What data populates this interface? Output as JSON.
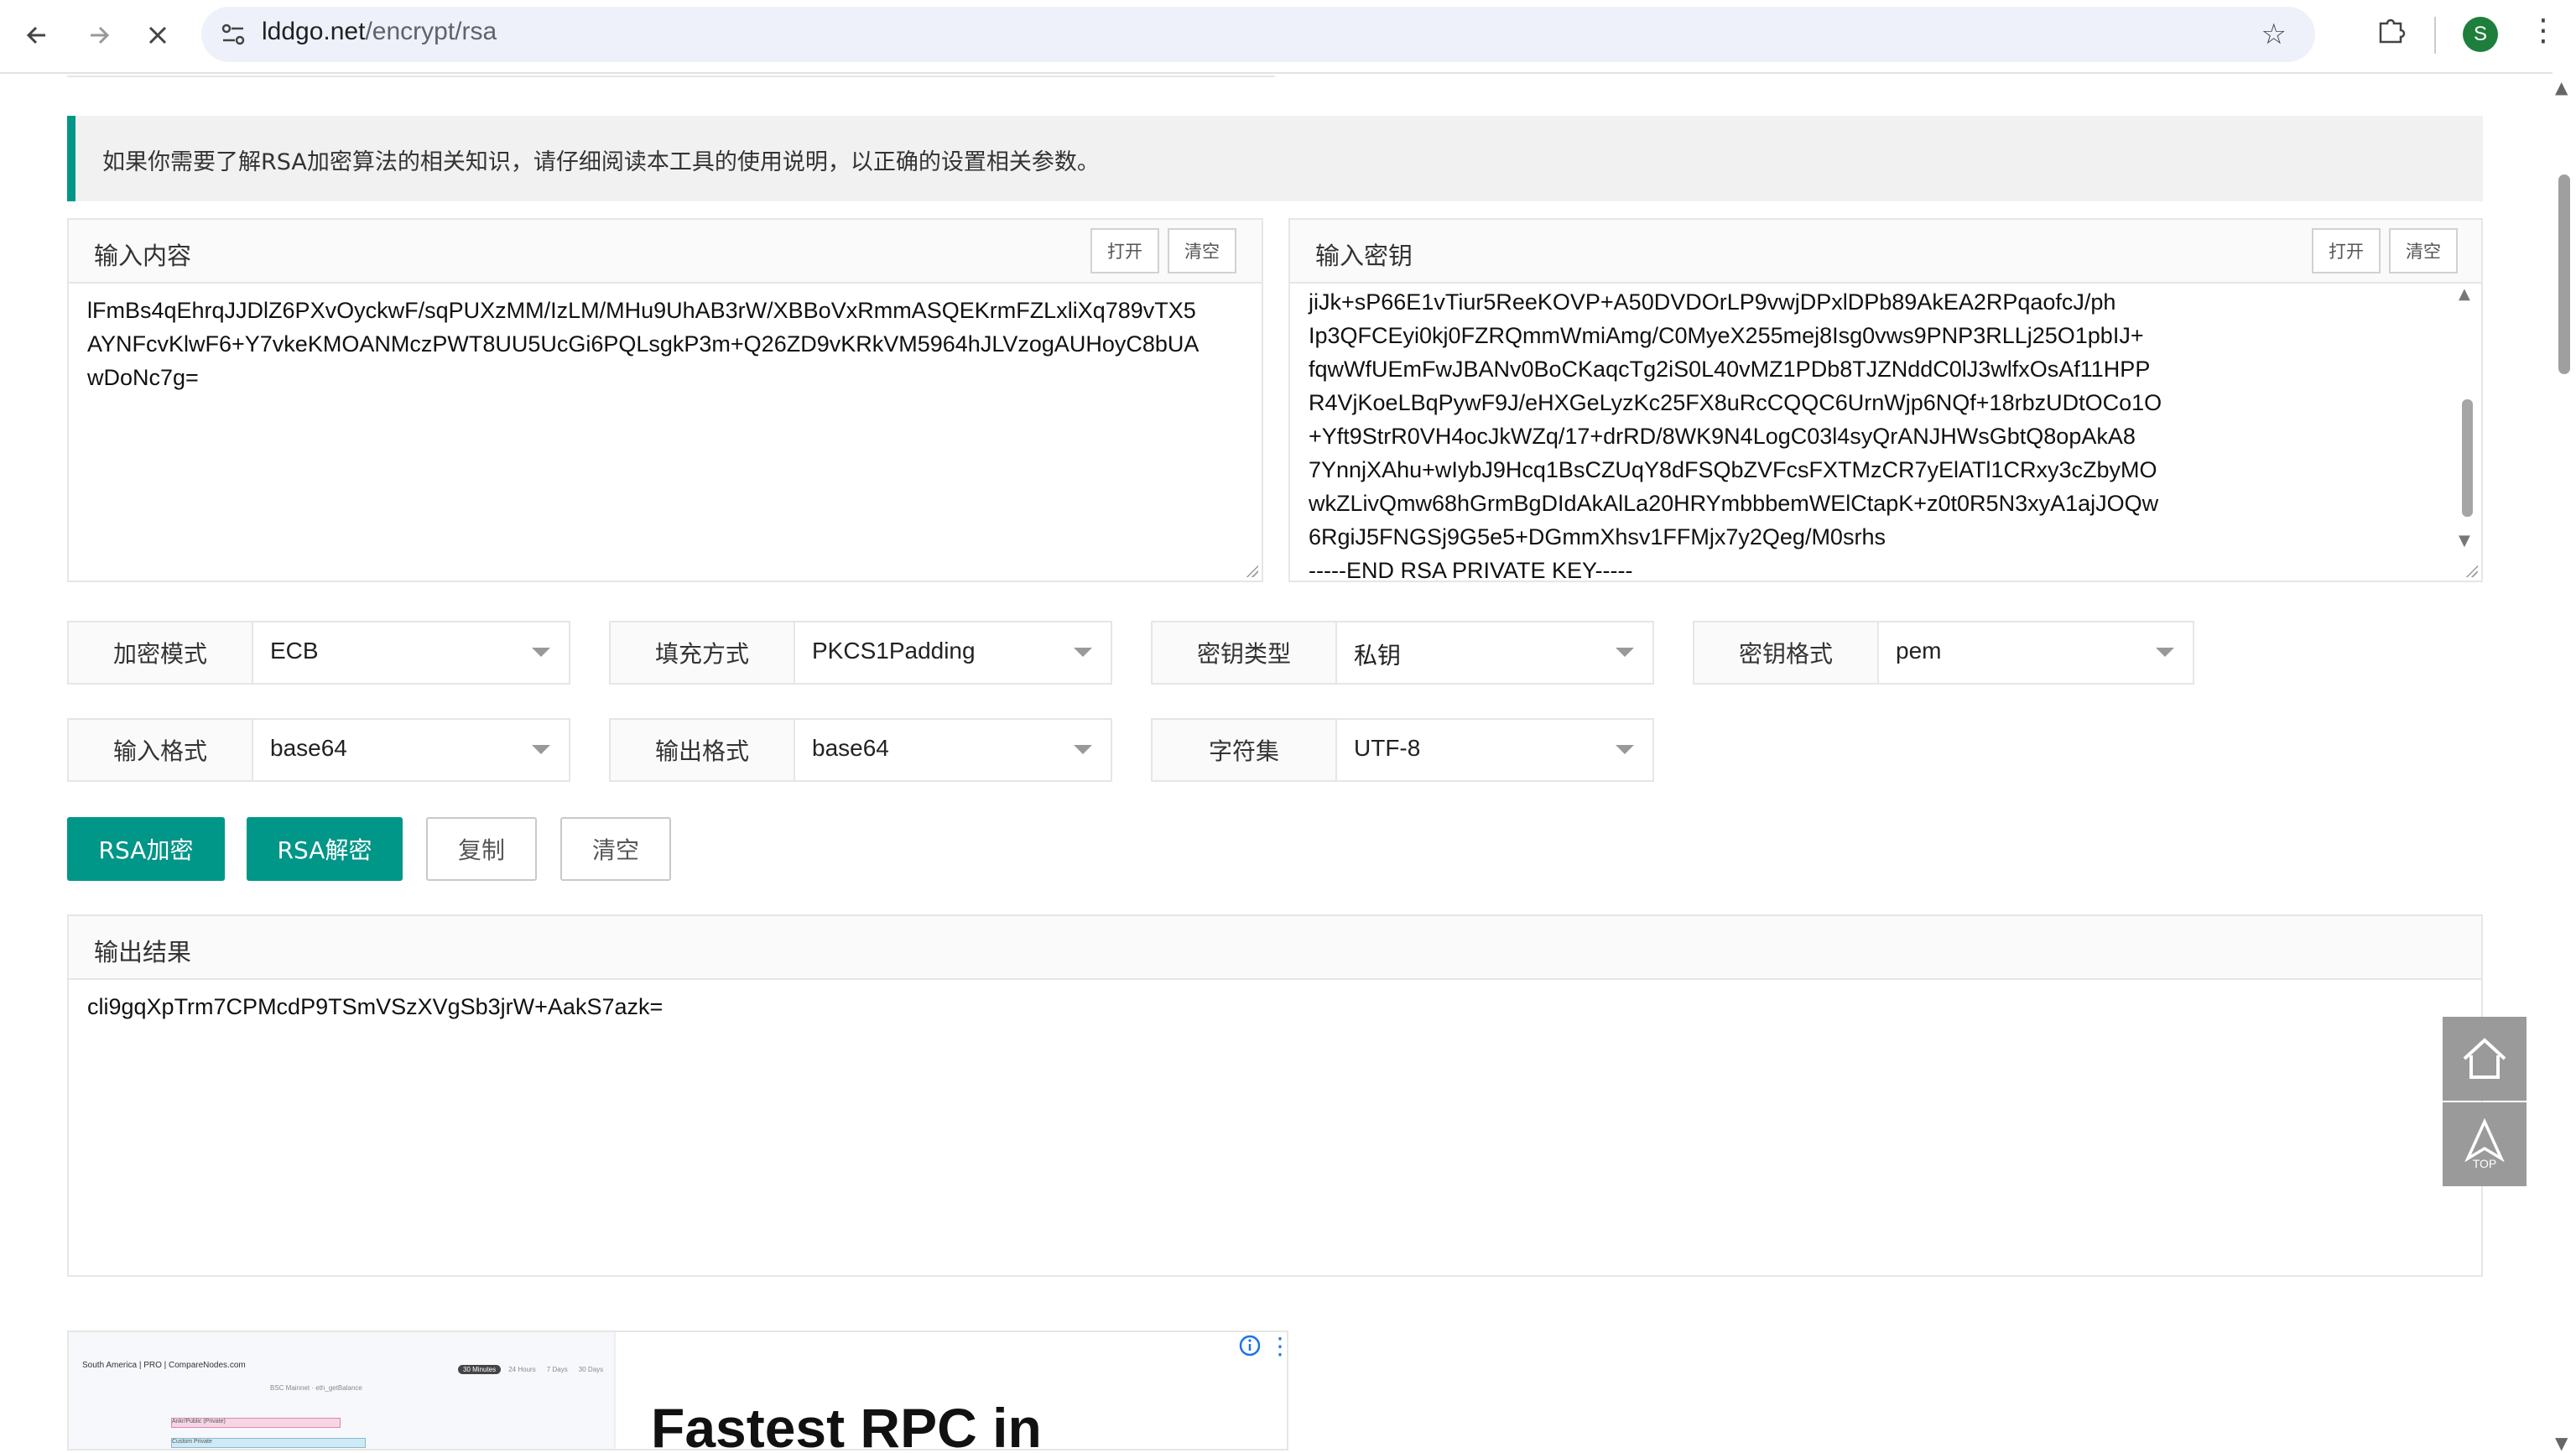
{
  "browser": {
    "url_host": "lddgo.net",
    "url_path": "/encrypt/rsa",
    "profile_initial": "S",
    "icons": {
      "back": "back-arrow-icon",
      "forward": "forward-arrow-icon",
      "stop": "close-icon",
      "site_info": "site-info-icon",
      "bookmark": "star-icon",
      "extensions": "puzzle-icon",
      "menu": "kebab-menu-icon"
    }
  },
  "notice": {
    "text": "如果你需要了解RSA加密算法的相关知识，请仔细阅读本工具的使用说明，以正确的设置相关参数。",
    "accent_color": "#009688"
  },
  "input_panel": {
    "title": "输入内容",
    "open_label": "打开",
    "clear_label": "清空",
    "lines": [
      "lFmBs4qEhrqJJDlZ6PXvOyckwF/sqPUXzMM/IzLM/MHu9UhAB3rW/XBBoVxRmmASQEKrmFZLxliXq789vTX5",
      "AYNFcvKlwF6+Y7vkeKMOANMczPWT8UU5UcGi6PQLsgkP3m+Q26ZD9vKRkVM5964hJLVzogAUHoyC8bUA",
      "wDoNc7g="
    ]
  },
  "key_panel": {
    "title": "输入密钥",
    "open_label": "打开",
    "clear_label": "清空",
    "lines": [
      "jiJk+sP66E1vTiur5ReeKOVP+A50DVDOrLP9vwjDPxlDPb89AkEA2RPqaofcJ/ph",
      "Ip3QFCEyi0kj0FZRQmmWmiAmg/C0MyeX255mej8Isg0vws9PNP3RLLj25O1pbIJ+",
      "fqwWfUEmFwJBANv0BoCKaqcTg2iS0L40vMZ1PDb8TJZNddC0lJ3wlfxOsAf11HPP",
      "R4VjKoeLBqPywF9J/eHXGeLyzKc25FX8uRcCQQC6UrnWjp6NQf+18rbzUDtOCo1O",
      "+Yft9StrR0VH4ocJkWZq/17+drRD/8WK9N4LogC03l4syQrANJHWsGbtQ8opAkA8",
      "7YnnjXAhu+wIybJ9Hcq1BsCZUqY8dFSQbZVFcsFXTMzCR7yElATl1CRxy3cZbyMO",
      "wkZLivQmw68hGrmBgDIdAkAlLa20HRYmbbbemWElCtapK+z0t0R5N3xyA1ajJOQw",
      "6RgiJ5FNGSj9G5e5+DGmmXhsv1FFMjx7y2Qeg/M0srhs",
      "-----END RSA PRIVATE KEY-----"
    ],
    "scrollbar": {
      "position_fraction": 0.6
    }
  },
  "options": [
    {
      "label": "加密模式",
      "value": "ECB"
    },
    {
      "label": "填充方式",
      "value": "PKCS1Padding"
    },
    {
      "label": "密钥类型",
      "value": "私钥"
    },
    {
      "label": "密钥格式",
      "value": "pem"
    },
    {
      "label": "输入格式",
      "value": "base64"
    },
    {
      "label": "输出格式",
      "value": "base64"
    },
    {
      "label": "字符集",
      "value": "UTF-8"
    }
  ],
  "actions": {
    "encrypt_label": "RSA加密",
    "decrypt_label": "RSA解密",
    "copy_label": "复制",
    "clear_label": "清空"
  },
  "output_panel": {
    "title": "输出结果",
    "value": "cli9gqXpTrm7CPMcdP9TSmVSzXVgSb3jrW+AakS7azk="
  },
  "float_buttons": {
    "home_icon": "home-icon",
    "top_icon": "back-to-top-icon",
    "top_label": "TOP"
  },
  "ad": {
    "preview_title": "South America | PRO | CompareNodes.com",
    "preview_tabs": [
      "30 Minutes",
      "24 Hours",
      "7 Days",
      "30 Days"
    ],
    "preview_caption": "BSC Mainnet · eth_getBalance",
    "preview_rows": [
      "Ankr/Public (Private)",
      "Custom Private"
    ],
    "headline": "Fastest RPC in",
    "info_icon": "info-icon",
    "menu_icon": "kebab-menu-icon"
  }
}
